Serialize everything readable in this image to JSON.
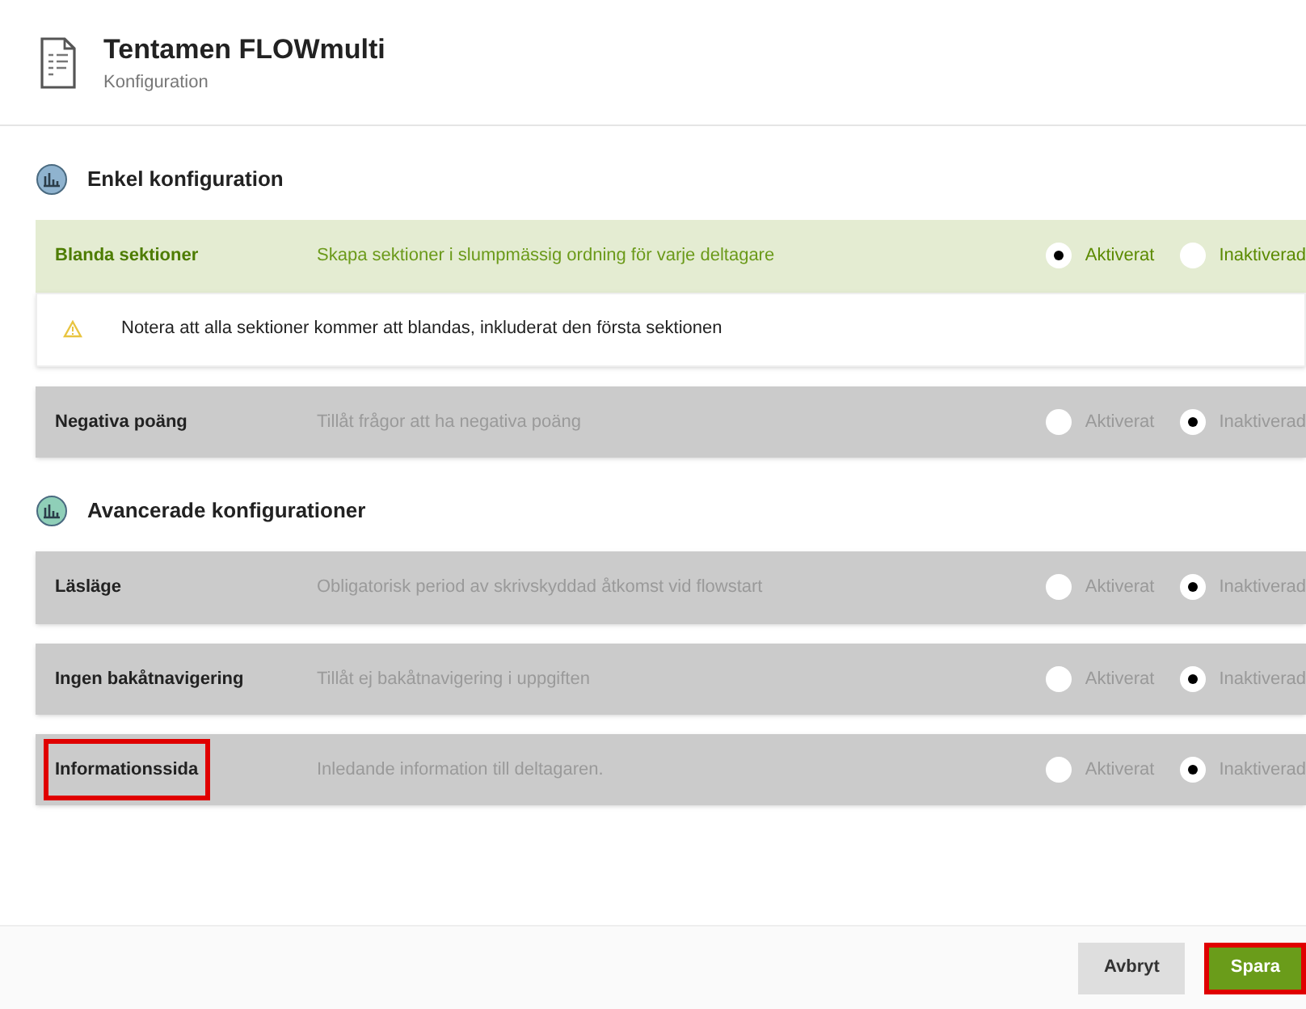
{
  "header": {
    "title": "Tentamen FLOWmulti",
    "subtitle": "Konfiguration"
  },
  "sections": [
    {
      "title": "Enkel konfiguration",
      "settings": [
        {
          "label": "Blanda sektioner",
          "description": "Skapa sektioner i slumpmässig ordning för varje deltagare",
          "highlighted": false,
          "options": [
            {
              "label": "Aktiverat",
              "selected": true
            },
            {
              "label": "Inaktiverad",
              "selected": false
            }
          ],
          "note": "Notera att alla sektioner kommer att blandas, inkluderat den första sektionen"
        },
        {
          "label": "Negativa poäng",
          "description": "Tillåt frågor att ha negativa poäng",
          "highlighted": false,
          "options": [
            {
              "label": "Aktiverat",
              "selected": false
            },
            {
              "label": "Inaktiverad",
              "selected": true
            }
          ]
        }
      ]
    },
    {
      "title": "Avancerade konfigurationer",
      "settings": [
        {
          "label": "Läsläge",
          "description": "Obligatorisk period av skrivskyddad åtkomst vid flowstart",
          "highlighted": false,
          "options": [
            {
              "label": "Aktiverat",
              "selected": false
            },
            {
              "label": "Inaktiverad",
              "selected": true
            }
          ]
        },
        {
          "label": "Ingen bakåtnavigering",
          "description": "Tillåt ej bakåtnavigering i uppgiften",
          "highlighted": false,
          "options": [
            {
              "label": "Aktiverat",
              "selected": false
            },
            {
              "label": "Inaktiverad",
              "selected": true
            }
          ]
        },
        {
          "label": "Informationssida",
          "description": "Inledande information till deltagaren.",
          "highlighted": true,
          "options": [
            {
              "label": "Aktiverat",
              "selected": false
            },
            {
              "label": "Inaktiverad",
              "selected": true
            }
          ]
        }
      ]
    }
  ],
  "buttons": [
    {
      "label": "Avbryt",
      "kind": "secondary",
      "highlighted": false
    },
    {
      "label": "Spara",
      "kind": "primary",
      "highlighted": true
    }
  ]
}
